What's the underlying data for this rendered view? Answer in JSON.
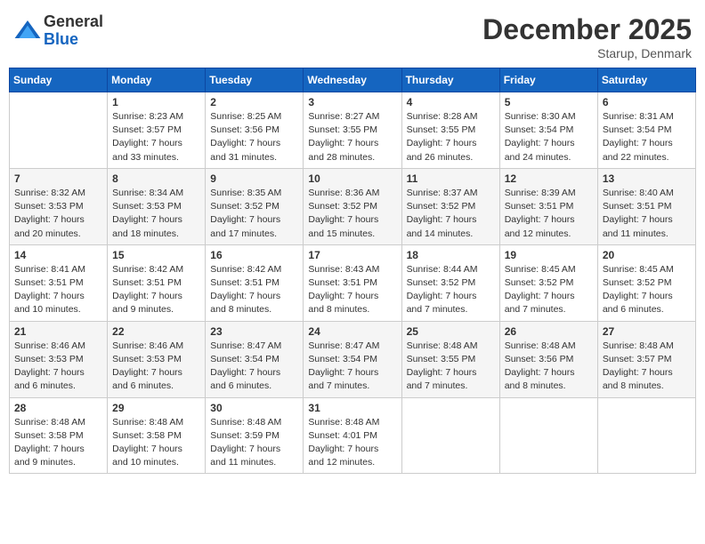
{
  "header": {
    "logo_line1": "General",
    "logo_line2": "Blue",
    "month": "December 2025",
    "location": "Starup, Denmark"
  },
  "weekdays": [
    "Sunday",
    "Monday",
    "Tuesday",
    "Wednesday",
    "Thursday",
    "Friday",
    "Saturday"
  ],
  "weeks": [
    [
      {
        "day": "",
        "sunrise": "",
        "sunset": "",
        "daylight": ""
      },
      {
        "day": "1",
        "sunrise": "Sunrise: 8:23 AM",
        "sunset": "Sunset: 3:57 PM",
        "daylight": "Daylight: 7 hours and 33 minutes."
      },
      {
        "day": "2",
        "sunrise": "Sunrise: 8:25 AM",
        "sunset": "Sunset: 3:56 PM",
        "daylight": "Daylight: 7 hours and 31 minutes."
      },
      {
        "day": "3",
        "sunrise": "Sunrise: 8:27 AM",
        "sunset": "Sunset: 3:55 PM",
        "daylight": "Daylight: 7 hours and 28 minutes."
      },
      {
        "day": "4",
        "sunrise": "Sunrise: 8:28 AM",
        "sunset": "Sunset: 3:55 PM",
        "daylight": "Daylight: 7 hours and 26 minutes."
      },
      {
        "day": "5",
        "sunrise": "Sunrise: 8:30 AM",
        "sunset": "Sunset: 3:54 PM",
        "daylight": "Daylight: 7 hours and 24 minutes."
      },
      {
        "day": "6",
        "sunrise": "Sunrise: 8:31 AM",
        "sunset": "Sunset: 3:54 PM",
        "daylight": "Daylight: 7 hours and 22 minutes."
      }
    ],
    [
      {
        "day": "7",
        "sunrise": "Sunrise: 8:32 AM",
        "sunset": "Sunset: 3:53 PM",
        "daylight": "Daylight: 7 hours and 20 minutes."
      },
      {
        "day": "8",
        "sunrise": "Sunrise: 8:34 AM",
        "sunset": "Sunset: 3:53 PM",
        "daylight": "Daylight: 7 hours and 18 minutes."
      },
      {
        "day": "9",
        "sunrise": "Sunrise: 8:35 AM",
        "sunset": "Sunset: 3:52 PM",
        "daylight": "Daylight: 7 hours and 17 minutes."
      },
      {
        "day": "10",
        "sunrise": "Sunrise: 8:36 AM",
        "sunset": "Sunset: 3:52 PM",
        "daylight": "Daylight: 7 hours and 15 minutes."
      },
      {
        "day": "11",
        "sunrise": "Sunrise: 8:37 AM",
        "sunset": "Sunset: 3:52 PM",
        "daylight": "Daylight: 7 hours and 14 minutes."
      },
      {
        "day": "12",
        "sunrise": "Sunrise: 8:39 AM",
        "sunset": "Sunset: 3:51 PM",
        "daylight": "Daylight: 7 hours and 12 minutes."
      },
      {
        "day": "13",
        "sunrise": "Sunrise: 8:40 AM",
        "sunset": "Sunset: 3:51 PM",
        "daylight": "Daylight: 7 hours and 11 minutes."
      }
    ],
    [
      {
        "day": "14",
        "sunrise": "Sunrise: 8:41 AM",
        "sunset": "Sunset: 3:51 PM",
        "daylight": "Daylight: 7 hours and 10 minutes."
      },
      {
        "day": "15",
        "sunrise": "Sunrise: 8:42 AM",
        "sunset": "Sunset: 3:51 PM",
        "daylight": "Daylight: 7 hours and 9 minutes."
      },
      {
        "day": "16",
        "sunrise": "Sunrise: 8:42 AM",
        "sunset": "Sunset: 3:51 PM",
        "daylight": "Daylight: 7 hours and 8 minutes."
      },
      {
        "day": "17",
        "sunrise": "Sunrise: 8:43 AM",
        "sunset": "Sunset: 3:51 PM",
        "daylight": "Daylight: 7 hours and 8 minutes."
      },
      {
        "day": "18",
        "sunrise": "Sunrise: 8:44 AM",
        "sunset": "Sunset: 3:52 PM",
        "daylight": "Daylight: 7 hours and 7 minutes."
      },
      {
        "day": "19",
        "sunrise": "Sunrise: 8:45 AM",
        "sunset": "Sunset: 3:52 PM",
        "daylight": "Daylight: 7 hours and 7 minutes."
      },
      {
        "day": "20",
        "sunrise": "Sunrise: 8:45 AM",
        "sunset": "Sunset: 3:52 PM",
        "daylight": "Daylight: 7 hours and 6 minutes."
      }
    ],
    [
      {
        "day": "21",
        "sunrise": "Sunrise: 8:46 AM",
        "sunset": "Sunset: 3:53 PM",
        "daylight": "Daylight: 7 hours and 6 minutes."
      },
      {
        "day": "22",
        "sunrise": "Sunrise: 8:46 AM",
        "sunset": "Sunset: 3:53 PM",
        "daylight": "Daylight: 7 hours and 6 minutes."
      },
      {
        "day": "23",
        "sunrise": "Sunrise: 8:47 AM",
        "sunset": "Sunset: 3:54 PM",
        "daylight": "Daylight: 7 hours and 6 minutes."
      },
      {
        "day": "24",
        "sunrise": "Sunrise: 8:47 AM",
        "sunset": "Sunset: 3:54 PM",
        "daylight": "Daylight: 7 hours and 7 minutes."
      },
      {
        "day": "25",
        "sunrise": "Sunrise: 8:48 AM",
        "sunset": "Sunset: 3:55 PM",
        "daylight": "Daylight: 7 hours and 7 minutes."
      },
      {
        "day": "26",
        "sunrise": "Sunrise: 8:48 AM",
        "sunset": "Sunset: 3:56 PM",
        "daylight": "Daylight: 7 hours and 8 minutes."
      },
      {
        "day": "27",
        "sunrise": "Sunrise: 8:48 AM",
        "sunset": "Sunset: 3:57 PM",
        "daylight": "Daylight: 7 hours and 8 minutes."
      }
    ],
    [
      {
        "day": "28",
        "sunrise": "Sunrise: 8:48 AM",
        "sunset": "Sunset: 3:58 PM",
        "daylight": "Daylight: 7 hours and 9 minutes."
      },
      {
        "day": "29",
        "sunrise": "Sunrise: 8:48 AM",
        "sunset": "Sunset: 3:58 PM",
        "daylight": "Daylight: 7 hours and 10 minutes."
      },
      {
        "day": "30",
        "sunrise": "Sunrise: 8:48 AM",
        "sunset": "Sunset: 3:59 PM",
        "daylight": "Daylight: 7 hours and 11 minutes."
      },
      {
        "day": "31",
        "sunrise": "Sunrise: 8:48 AM",
        "sunset": "Sunset: 4:01 PM",
        "daylight": "Daylight: 7 hours and 12 minutes."
      },
      {
        "day": "",
        "sunrise": "",
        "sunset": "",
        "daylight": ""
      },
      {
        "day": "",
        "sunrise": "",
        "sunset": "",
        "daylight": ""
      },
      {
        "day": "",
        "sunrise": "",
        "sunset": "",
        "daylight": ""
      }
    ]
  ]
}
